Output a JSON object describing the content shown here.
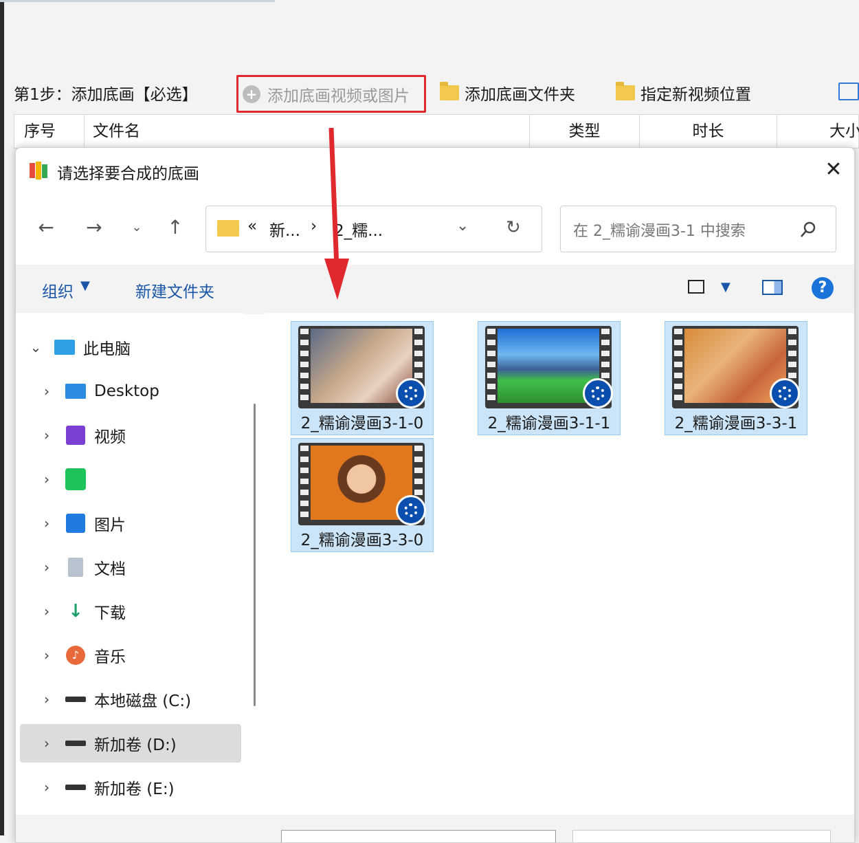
{
  "app": {
    "step_label": "第1步：添加底画【必选】",
    "add_video_label": "添加底画视频或图片",
    "add_folder_label": "添加底画文件夹",
    "set_location_label": "指定新视频位置",
    "columns": [
      "序号",
      "文件名",
      "类型",
      "时长",
      "大小"
    ]
  },
  "dialog": {
    "title": "请选择要合成的底画",
    "address": {
      "prefix": "«",
      "crumb1": "新...",
      "separator": "›",
      "crumb2": "2_糯..."
    },
    "search_placeholder": "在 2_糯谕漫画3-1 中搜索",
    "cmd": {
      "organize": "组织",
      "new_folder": "新建文件夹"
    },
    "sidebar": [
      {
        "label": "此电脑",
        "icon": "pc-icon",
        "expanded": true
      },
      {
        "label": "Desktop",
        "icon": "desktop-icon"
      },
      {
        "label": "视频",
        "icon": "video-library-icon"
      },
      {
        "label": "",
        "icon": "iqiyi-icon"
      },
      {
        "label": "图片",
        "icon": "pictures-icon"
      },
      {
        "label": "文档",
        "icon": "documents-icon"
      },
      {
        "label": "下载",
        "icon": "downloads-icon"
      },
      {
        "label": "音乐",
        "icon": "music-icon"
      },
      {
        "label": "本地磁盘 (C:)",
        "icon": "drive-c-icon"
      },
      {
        "label": "新加卷 (D:)",
        "icon": "drive-d-icon",
        "selected": true
      },
      {
        "label": "新加卷 (E:)",
        "icon": "drive-e-icon"
      }
    ],
    "files": [
      {
        "name": "2_糯谕漫画3-1-0",
        "icon": "video-file-icon"
      },
      {
        "name": "2_糯谕漫画3-1-1",
        "icon": "video-file-icon"
      },
      {
        "name": "2_糯谕漫画3-3-1",
        "icon": "video-file-icon"
      },
      {
        "name": "2_糯谕漫画3-3-0",
        "icon": "video-file-icon"
      }
    ]
  },
  "colors": {
    "highlight_border": "#e0282f",
    "arrow": "#e0282f",
    "selection": "#cce4f7",
    "accent": "#0b4fae"
  }
}
